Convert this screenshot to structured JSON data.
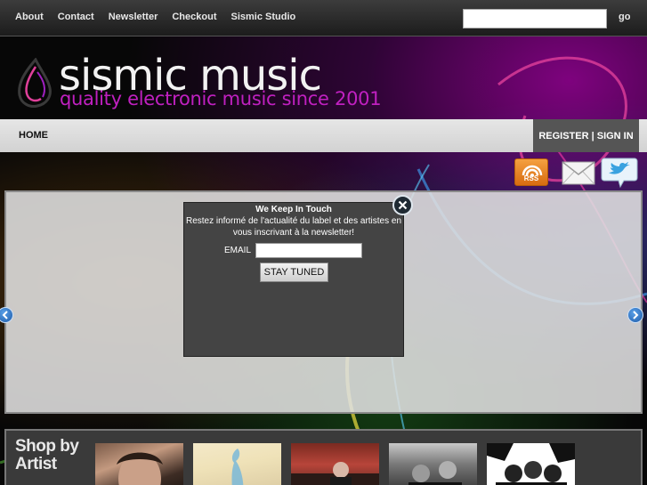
{
  "topnav": {
    "items": [
      {
        "label": "About"
      },
      {
        "label": "Contact"
      },
      {
        "label": "Newsletter"
      },
      {
        "label": "Checkout"
      },
      {
        "label": "Sismic Studio"
      }
    ],
    "search_value": "",
    "go_label": "go"
  },
  "header": {
    "title": "sismic music",
    "tagline": "quality electronic music since 2001"
  },
  "mainnav": {
    "home_label": "HOME",
    "register_label": "REGISTER | SIGN IN"
  },
  "social": {
    "rss_label": "RSS"
  },
  "popup": {
    "title": "We Keep In Touch",
    "text": "Restez informé de l'actualité du label et des artistes en vous inscrivant à la newsletter!",
    "email_label": "EMAIL",
    "email_value": "",
    "submit_label": "STAY TUNED"
  },
  "shop": {
    "title": "Shop by Artist"
  },
  "colors": {
    "tagline": "#c020c0",
    "accent_blue": "#1d5aa8",
    "rss_orange": "#e8801e"
  }
}
